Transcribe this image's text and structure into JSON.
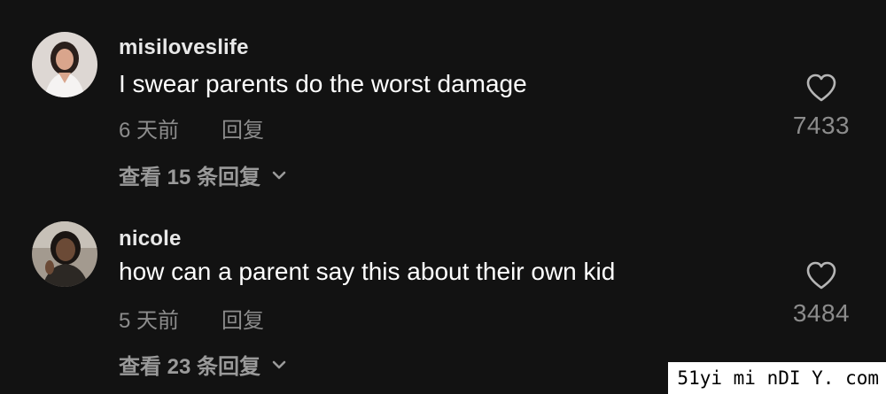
{
  "comments": [
    {
      "username": "misiloveslife",
      "text": "I swear parents do the worst damage",
      "time": "6 天前",
      "reply_label": "回复",
      "likes": "7433",
      "view_replies": "查看 15 条回复"
    },
    {
      "username": "nicole",
      "text": "how can a parent say this about their own kid",
      "time": "5 天前",
      "reply_label": "回复",
      "likes": "3484",
      "view_replies": "查看 23 条回复"
    }
  ],
  "icons": {
    "like": "heart-outline-icon",
    "expand": "chevron-down-icon"
  },
  "colors": {
    "background": "#121212",
    "primary_text": "#ffffff",
    "secondary_text": "#8c8c8c"
  },
  "watermark": "51yi mi nDI Y. com"
}
